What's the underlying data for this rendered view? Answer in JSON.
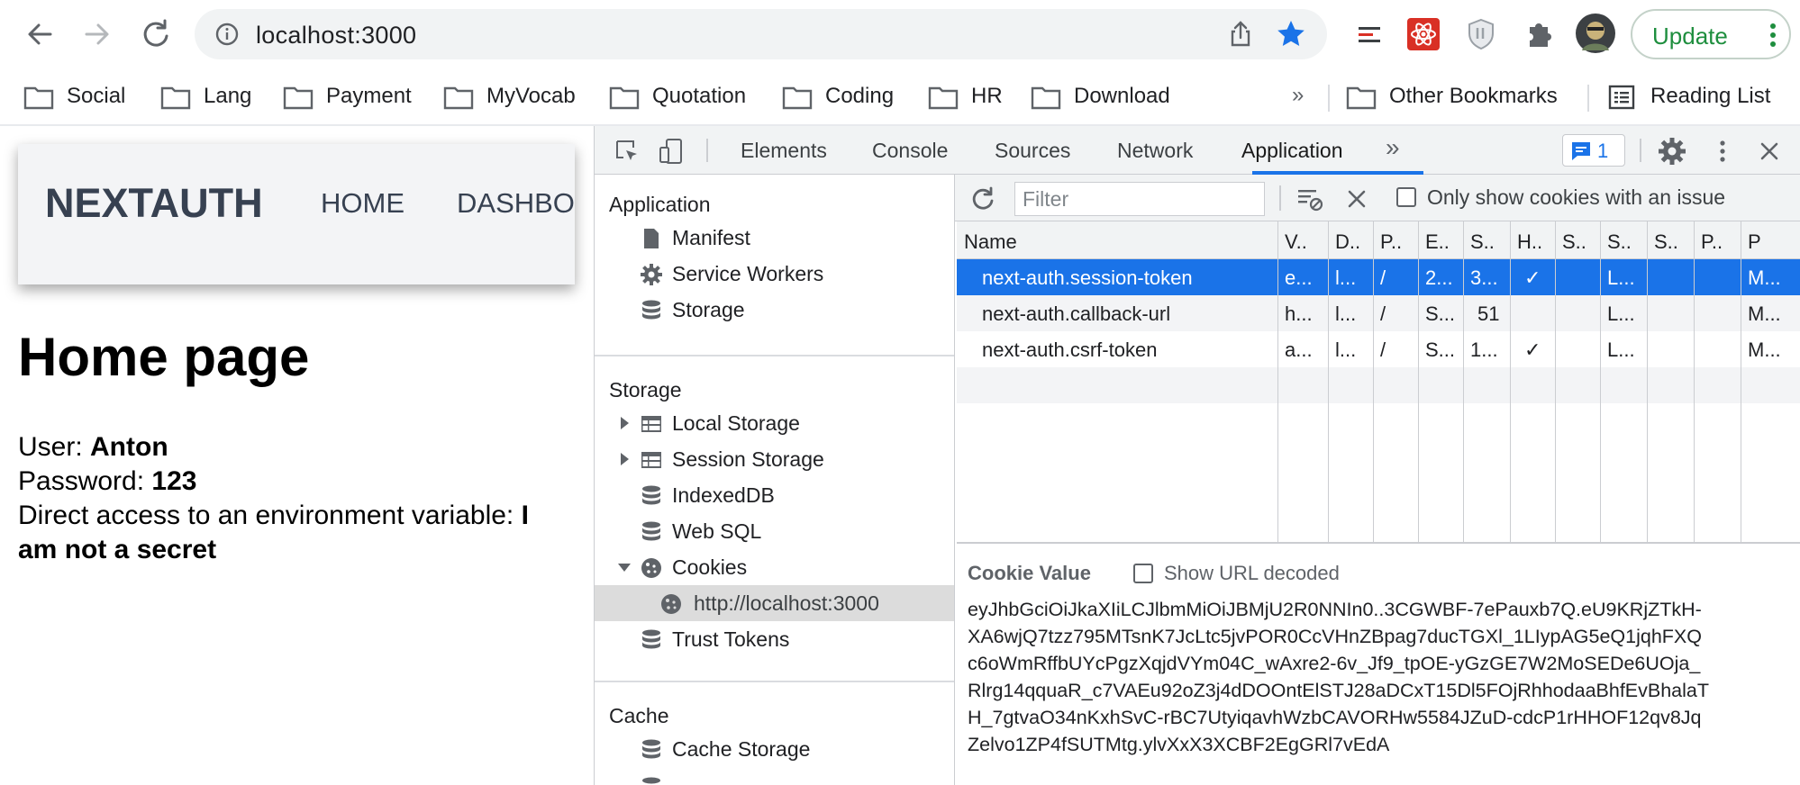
{
  "browser": {
    "url": "localhost:3000",
    "update_label": "Update",
    "accent": "#1e8e3e",
    "bookmarks": [
      "Social",
      "Lang",
      "Payment",
      "MyVocab",
      "Quotation",
      "Coding",
      "HR",
      "Download"
    ],
    "more_label": "»",
    "other_bookmarks": "Other Bookmarks",
    "reading_list": "Reading List"
  },
  "page": {
    "brand": "NEXTAUTH",
    "nav": [
      "HOME",
      "DASHBOARD"
    ],
    "title": "Home page",
    "user_label": "User: ",
    "user_value": "Anton",
    "password_label": "Password: ",
    "password_value": "123",
    "env_label": "Direct access to an environment variable: ",
    "env_value_1": "I",
    "env_value_2": "am not a secret"
  },
  "devtools": {
    "tabs": [
      "Elements",
      "Console",
      "Sources",
      "Network",
      "Application"
    ],
    "active_tab": "Application",
    "more_tabs": "»",
    "issues_count": "1",
    "sidebar": {
      "application_header": "Application",
      "application_items": [
        "Manifest",
        "Service Workers",
        "Storage"
      ],
      "storage_header": "Storage",
      "storage_items": [
        "Local Storage",
        "Session Storage",
        "IndexedDB",
        "Web SQL",
        "Cookies"
      ],
      "cookie_origin": "http://localhost:3000",
      "trust_tokens": "Trust Tokens",
      "cache_header": "Cache",
      "cache_items": [
        "Cache Storage"
      ]
    },
    "cookies": {
      "filter_placeholder": "Filter",
      "only_issues_label": "Only show cookies with an issue",
      "columns": [
        "Name",
        "V..",
        "D..",
        "P..",
        "E..",
        "S..",
        "H..",
        "S..",
        "S..",
        "S..",
        "P..",
        "P"
      ],
      "rows": [
        [
          "next-auth.session-token",
          "e...",
          "l...",
          "/",
          "2...",
          "3...",
          "✓",
          "",
          "L...",
          "",
          "",
          "M..."
        ],
        [
          "next-auth.callback-url",
          "h...",
          "l...",
          "/",
          "S...",
          "51",
          "",
          "",
          "L...",
          "",
          "",
          "M..."
        ],
        [
          "next-auth.csrf-token",
          "a...",
          "l...",
          "/",
          "S...",
          "1...",
          "✓",
          "",
          "L...",
          "",
          "",
          "M..."
        ]
      ],
      "selected_row": 0,
      "value_title": "Cookie Value",
      "show_decoded_label": "Show URL decoded",
      "value_text": "eyJhbGciOiJkaXIiLCJlbmMiOiJBMjU2R0NNIn0..3CGWBF-7ePauxb7Q.eU9KRjZTkH-\nXA6wjQ7tzz795MTsnK7JcLtc5jvPOR0CcVHnZBpag7ducTGXl_1LIypAG5eQ1jqhFXQ\nc6oWmRffbUYcPgzXqjdVYm04C_wAxre2-6v_Jf9_tpOE-yGzGE7W2MoSEDe6UOja_\nRlrg14qquaR_c7VAEu92oZ3j4dDOOntElSTJ28aDCxT15Dl5FOjRhhodaaBhfEvBhalaT\nH_7gtvaO34nKxhSvC-rBC7UtyiqavhWzbCAVORHw5584JZuD-cdcP1rHHOF12qv8Jq\nZelvo1ZP4fSUTMtg.ylvXxX3XCBF2EgGRl7vEdA"
    }
  }
}
